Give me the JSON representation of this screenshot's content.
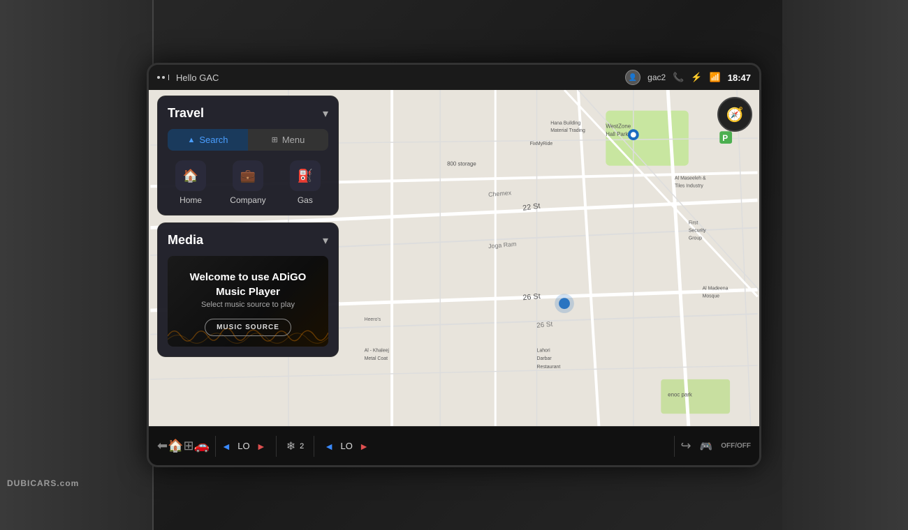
{
  "screen": {
    "statusBar": {
      "dotsLabel": "signal",
      "greeting": "Hello GAC",
      "user": "gac2",
      "time": "18:47"
    },
    "travelPanel": {
      "title": "Travel",
      "chevron": "▾",
      "tabs": [
        {
          "id": "search",
          "label": "Search",
          "icon": "▲",
          "active": true
        },
        {
          "id": "menu",
          "label": "Menu",
          "icon": "⊞",
          "active": false
        }
      ],
      "destinations": [
        {
          "id": "home",
          "label": "Home",
          "icon": "🏠"
        },
        {
          "id": "company",
          "label": "Company",
          "icon": "💼"
        },
        {
          "id": "gas",
          "label": "Gas",
          "icon": "⛽"
        }
      ]
    },
    "mediaPanel": {
      "title": "Media",
      "chevron": "▾",
      "musicTitle": "Welcome to use ADiGO",
      "musicTitleLine2": "Music Player",
      "musicSubtitle": "Select music source to play",
      "musicSourceBtn": "MUSIC SOURCE"
    },
    "bottomBar": {
      "icons": [
        "⬅",
        "🏠",
        "⊞",
        "🚗"
      ],
      "climate": {
        "leftTemp": "LO",
        "rightTemp": "LO",
        "fanSpeed": "2",
        "fanIcon": "❄"
      },
      "rightControls": [
        "↪",
        "🎮",
        "OFF/OFF"
      ]
    },
    "map": {
      "roads": [
        {
          "label": "22 St",
          "type": "major"
        },
        {
          "label": "26 St",
          "type": "major"
        },
        {
          "label": "Joga Ram",
          "type": "minor"
        },
        {
          "label": "Chemex",
          "type": "minor"
        },
        {
          "label": "800 storage",
          "type": "label"
        },
        {
          "label": "Heero's",
          "type": "label"
        },
        {
          "label": "Al - Khaleej Metal Coat",
          "type": "poi"
        },
        {
          "label": "Lahori Darbar Restaurant",
          "type": "poi"
        },
        {
          "label": "enoc park",
          "type": "poi"
        },
        {
          "label": "WestZone Hall Park",
          "type": "poi"
        },
        {
          "label": "Al Maseeleh & Tiles Industry",
          "type": "poi"
        },
        {
          "label": "First Security Group",
          "type": "poi"
        },
        {
          "label": "Al Madeena Mosque",
          "type": "poi"
        },
        {
          "label": "Hana Building Material Trading",
          "type": "poi"
        },
        {
          "label": "FixMyRide",
          "type": "poi"
        }
      ]
    }
  },
  "watermark": "DUBICARS.com"
}
